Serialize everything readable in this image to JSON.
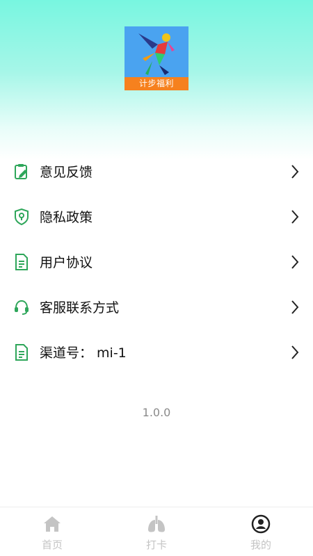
{
  "app": {
    "logo_text": "计步福利",
    "colors": {
      "accent": "#2ea65a",
      "header_top": "#78f6e0",
      "logo_bg": "#4aa3f0",
      "logo_band": "#f6811e",
      "tab_inactive": "#c4c4c4",
      "tab_active": "#222222"
    }
  },
  "menu": {
    "items": [
      {
        "label": "意见反馈",
        "icon": "feedback-clipboard-icon"
      },
      {
        "label": "隐私政策",
        "icon": "privacy-shield-icon"
      },
      {
        "label": "用户协议",
        "icon": "document-icon"
      },
      {
        "label": "客服联系方式",
        "icon": "headset-icon"
      },
      {
        "label": "渠道号： mi-1",
        "icon": "document-icon"
      }
    ]
  },
  "version": "1.0.0",
  "tabbar": {
    "tabs": [
      {
        "label": "首页",
        "icon": "home-icon",
        "active": false
      },
      {
        "label": "打卡",
        "icon": "lungs-icon",
        "active": false
      },
      {
        "label": "我的",
        "icon": "user-circle-icon",
        "active": true
      }
    ]
  }
}
